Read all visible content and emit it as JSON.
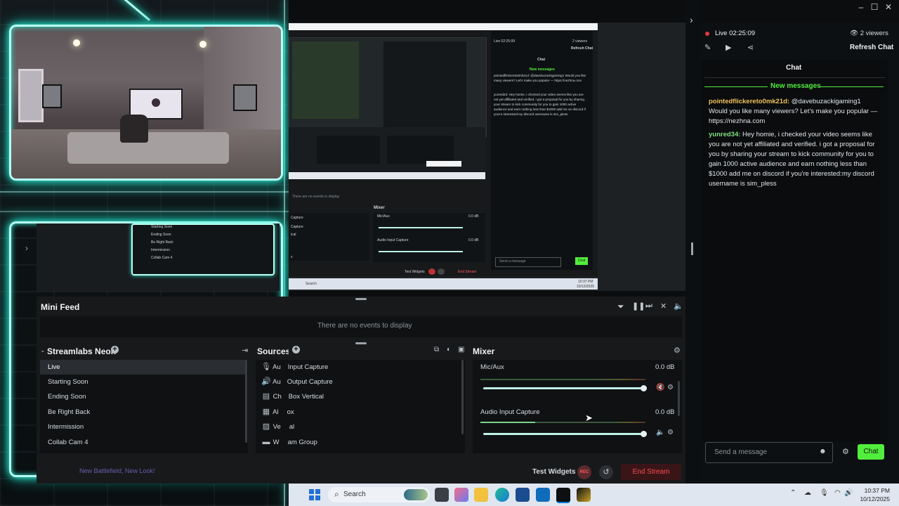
{
  "chat": {
    "live_label": "Live",
    "live_time": "02:25:09",
    "viewers": "2 viewers",
    "refresh_label": "Refresh Chat",
    "title": "Chat",
    "new_messages": "New messages",
    "messages": [
      {
        "user": "pointedflickereto0mk21d:",
        "text": " @davebuzackigaming1 Would you like many viewers? Let's make you popular — https://nezhna.com"
      },
      {
        "user": "yunred34:",
        "text": " Hey homie, i checked your video seems like you are not yet affiliated and verified. i got a proposal for you by sharing your stream to kick community for you to gain 1000 active audience and earn nothing less than $1000 add me on discord if you're interested:my discord username is sim_pless"
      }
    ],
    "input_placeholder": "Send a message",
    "send_label": "Chat"
  },
  "nested": {
    "live_label": "Live 02:25:09",
    "viewers": "2 viewers",
    "refresh": "Refresh Chat",
    "chat_title": "Chat",
    "new_messages": "New messages",
    "msg1": "pointedflickereto0mk21d: @davebuzackigaming1 Would you like many viewers? Let's make you popular — https://nezhna.com",
    "msg2": "yunred34: Hey homie, i checked your video seems like you are not yet affiliated and verified. i got a proposal for you by sharing your stream to kick community for you to gain 1000 active audience and earn nothing less than $1000 add me on discord if you're interested:my discord username is sim_pless",
    "send_placeholder": "Send a message",
    "send_label": "Chat",
    "no_events": "There are no events to display",
    "mixer": "Mixer",
    "mic": "Mic/Aux",
    "mic_db": "0.0 dB",
    "audio_input": "Audio Input Capture",
    "audio_db": "0.0 dB",
    "test_widgets": "Test Widgets",
    "end_stream": "End Stream",
    "search": "Search",
    "time": "10:37 PM",
    "date": "10/12/2025",
    "sources": [
      "Capture",
      "Capture",
      "ical",
      "x"
    ],
    "scenes": [
      "Starting Soon",
      "Ending Soon",
      "Be Right Back",
      "Intermission",
      "Collab Cam 4"
    ]
  },
  "minifeed": {
    "title": "Mini Feed",
    "empty": "There are no events to display"
  },
  "scenes": {
    "title": "Streamlabs Neon",
    "items": [
      "Live",
      "Starting Soon",
      "Ending Soon",
      "Be Right Back",
      "Intermission",
      "Collab Cam 4"
    ],
    "footer_note": "New Battlefield, New Look!"
  },
  "sources": {
    "title": "Sources",
    "items": [
      "Audio Input Capture",
      "Audio Output Capture",
      "Chat Box Vertical",
      "Alert Box",
      "Vertical",
      "Webcam Group"
    ],
    "visible_text": [
      "Au",
      "Input Capture",
      "Au",
      "Output Capture",
      "Ch",
      "Box Vertical",
      "Al",
      "ox",
      "Ve",
      "al",
      "W",
      "am Group"
    ]
  },
  "mixer": {
    "title": "Mixer",
    "channels": [
      {
        "name": "Mic/Aux",
        "db": "0.0 dB",
        "level": 1.0
      },
      {
        "name": "Audio Input Capture",
        "db": "0.0 dB",
        "level": 1.0
      }
    ]
  },
  "footer": {
    "test_widgets": "Test Widgets",
    "rec_label": "REC",
    "end_stream": "End Stream"
  },
  "taskbar": {
    "search": "Search",
    "time": "10:37 PM",
    "date": "10/12/2025"
  },
  "colors": {
    "neon": "#b8fff4",
    "accent_green": "#52ee3d",
    "end_stream": "#ff4d4d",
    "live_dot": "#e53935"
  }
}
